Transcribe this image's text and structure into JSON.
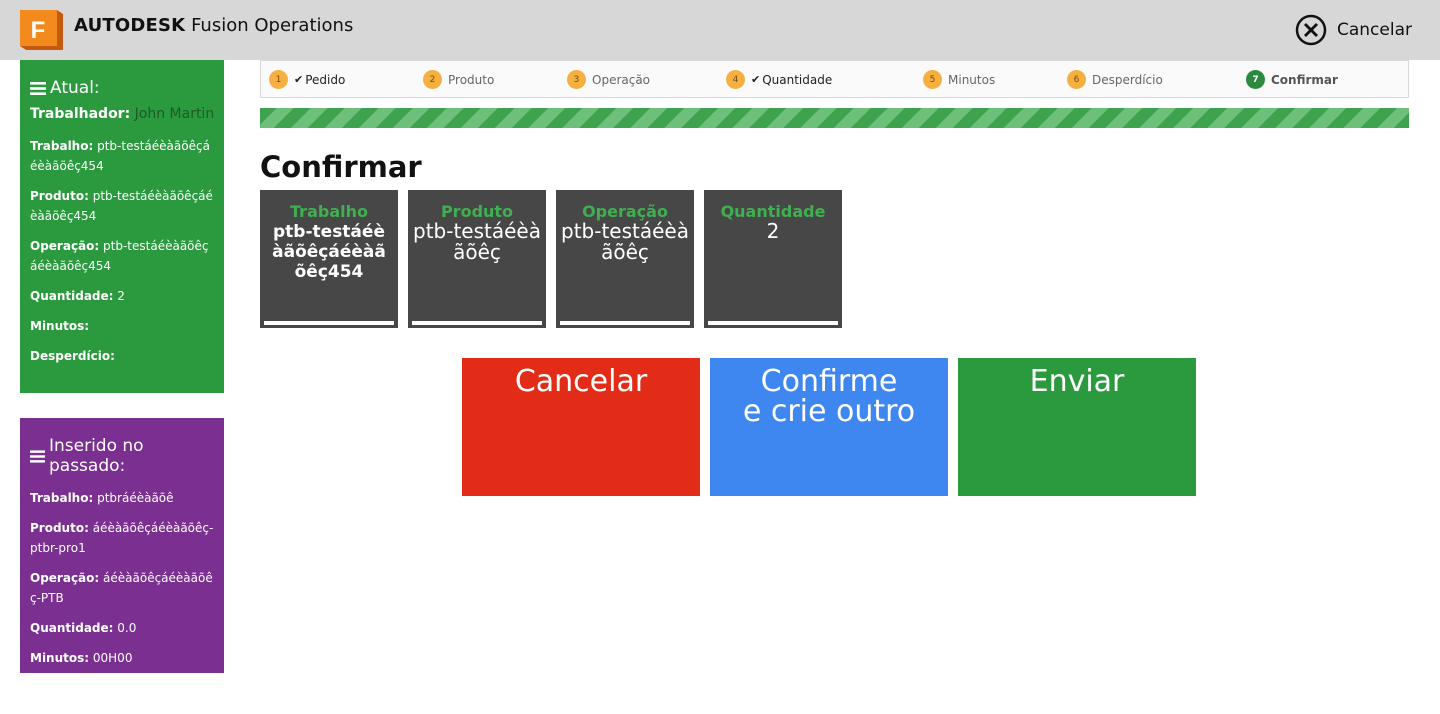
{
  "header": {
    "brand_bold": "AUTODESK",
    "brand_rest": "Fusion Operations",
    "cancel_label": "Cancelar",
    "logo_letter": "F"
  },
  "current": {
    "title": "Atual:",
    "worker_label": "Trabalhador:",
    "worker_name": "John Martin",
    "fields": [
      {
        "label": "Trabalho:",
        "value": "ptb-testáéèàãõêçáéèàãõêç454"
      },
      {
        "label": "Produto:",
        "value": "ptb-testáéèàãõêçáéèàãõêç454"
      },
      {
        "label": "Operação:",
        "value": "ptb-testáéèàãõêçáéèàãõêç454"
      },
      {
        "label": "Quantidade:",
        "value": "2"
      },
      {
        "label": "Minutos:",
        "value": ""
      },
      {
        "label": "Desperdício:",
        "value": ""
      }
    ]
  },
  "past": {
    "title": "Inserido no passado:",
    "fields": [
      {
        "label": "Trabalho:",
        "value": "ptbráéèàãõê"
      },
      {
        "label": "Produto:",
        "value": "áéèàãõêçáéèàãõêç-ptbr-pro1"
      },
      {
        "label": "Operação:",
        "value": "áéèàãõêçáéèàãõêç-PTB"
      },
      {
        "label": "Quantidade:",
        "value": "0.0"
      },
      {
        "label": "Minutos:",
        "value": "00H00"
      }
    ]
  },
  "steps": [
    {
      "num": "1",
      "label": "Pedido",
      "checked": true
    },
    {
      "num": "2",
      "label": "Produto",
      "checked": false
    },
    {
      "num": "3",
      "label": "Operação",
      "checked": false
    },
    {
      "num": "4",
      "label": "Quantidade",
      "checked": true
    },
    {
      "num": "5",
      "label": "Minutos",
      "checked": false
    },
    {
      "num": "6",
      "label": "Desperdício",
      "checked": false
    },
    {
      "num": "7",
      "label": "Confirmar",
      "checked": false,
      "active": true
    }
  ],
  "page_title": "Confirmar",
  "tiles": [
    {
      "label": "Trabalho",
      "value": "ptb-testáéèàãõêçáéèàãõêç454"
    },
    {
      "label": "Produto",
      "value": "ptb-testáéèàãõêç"
    },
    {
      "label": "Operação",
      "value": "ptb-testáéèàãõêç"
    },
    {
      "label": "Quantidade",
      "value": "2"
    }
  ],
  "actions": {
    "cancel": "Cancelar",
    "confirm_line1": "Confirme",
    "confirm_line2": "e crie outro",
    "send": "Enviar"
  },
  "colors": {
    "current_panel": "#2b9a3f",
    "past_panel": "#7b2f91",
    "cancel": "#e32c17",
    "confirm": "#3f87f0",
    "send": "#2b9a3f",
    "step_circle": "#f5b041",
    "step_active": "#2b8a3e"
  }
}
